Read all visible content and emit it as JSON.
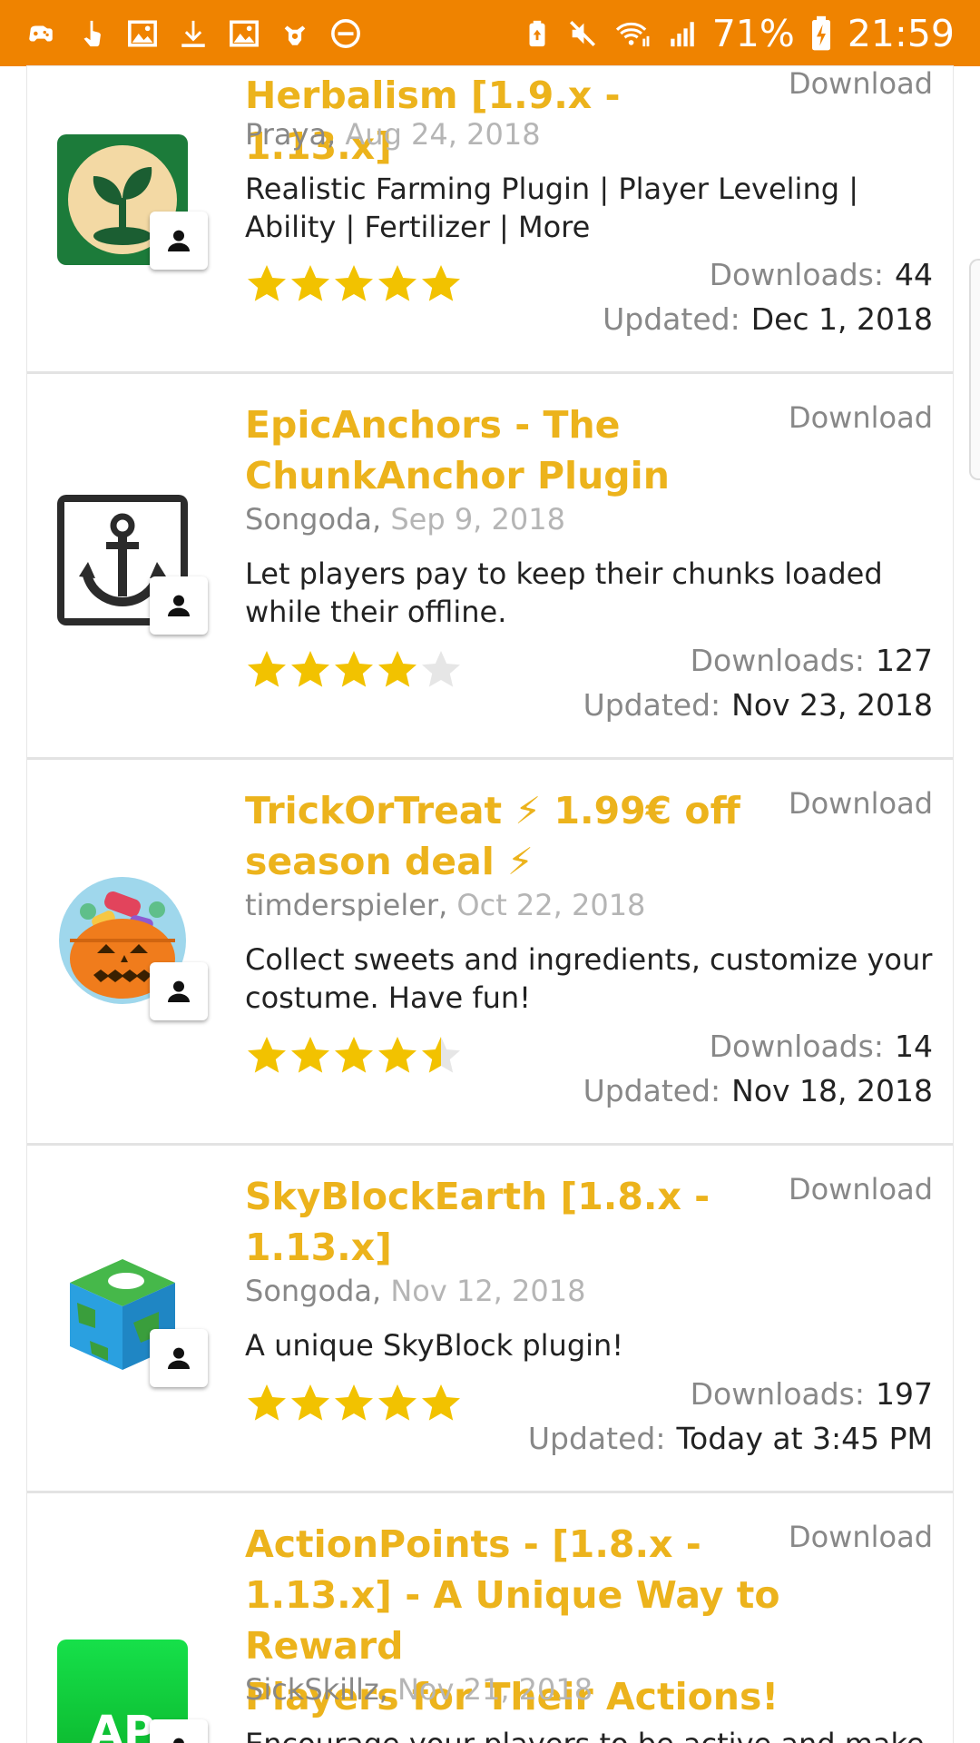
{
  "status_bar": {
    "battery": "71%",
    "time": "21:59",
    "left_icons": [
      "game-controller-icon",
      "tap-icon",
      "image-icon",
      "download-icon",
      "image-icon",
      "bug-icon",
      "do-not-disturb-icon"
    ],
    "right_icons": [
      "battery-saver-icon",
      "mute-icon",
      "wifi-icon",
      "signal-icon",
      "battery-icon"
    ]
  },
  "colors": {
    "accent": "#ef8300",
    "title": "#ecb31c",
    "star": "#f2c200",
    "star_empty": "#e6e6e6"
  },
  "resources": [
    {
      "title_lines": [
        "Herbalism [1.9.x - 1.13.x]"
      ],
      "download_label": "Download",
      "author": "Praya",
      "date": "Aug 24, 2018",
      "description": "Realistic Farming Plugin | Player Leveling | Ability | Fertilizer | More",
      "rating": 5,
      "downloads_label": "Downloads:",
      "downloads": "44",
      "updated_label": "Updated:",
      "updated": "Dec 1, 2018",
      "icon": "sprout-icon"
    },
    {
      "title_lines": [
        "EpicAnchors - The",
        "ChunkAnchor Plugin"
      ],
      "download_label": "Download",
      "author": "Songoda",
      "date": "Sep 9, 2018",
      "description": "Let players pay to keep their chunks loaded while their offline.",
      "rating": 4,
      "downloads_label": "Downloads:",
      "downloads": "127",
      "updated_label": "Updated:",
      "updated": "Nov 23, 2018",
      "icon": "anchor-icon"
    },
    {
      "title_lines": [
        "TrickOrTreat ⚡ 1.99€ off",
        "season deal ⚡"
      ],
      "download_label": "Download",
      "author": "timderspieler",
      "date": "Oct 22, 2018",
      "description": "Collect sweets and ingredients, customize your costume. Have fun!",
      "rating": 4.5,
      "downloads_label": "Downloads:",
      "downloads": "14",
      "updated_label": "Updated:",
      "updated": "Nov 18, 2018",
      "icon": "pumpkin-icon"
    },
    {
      "title_lines": [
        "SkyBlockEarth [1.8.x -",
        "1.13.x]"
      ],
      "download_label": "Download",
      "author": "Songoda",
      "date": "Nov 12, 2018",
      "description": "A unique SkyBlock plugin!",
      "rating": 5,
      "downloads_label": "Downloads:",
      "downloads": "197",
      "updated_label": "Updated:",
      "updated": "Today at 3:45 PM",
      "icon": "earth-cube-icon"
    },
    {
      "title_lines": [
        "ActionPoints - [1.8.x -",
        "1.13.x] - A Unique Way to Reward",
        "Players for Their Actions!"
      ],
      "download_label": "Download",
      "author": "SickSkillz",
      "date": "Nov 21, 2018",
      "description": "Encourage your players to be active and make",
      "icon_text": "AP",
      "icon": "ap-logo-icon"
    }
  ]
}
